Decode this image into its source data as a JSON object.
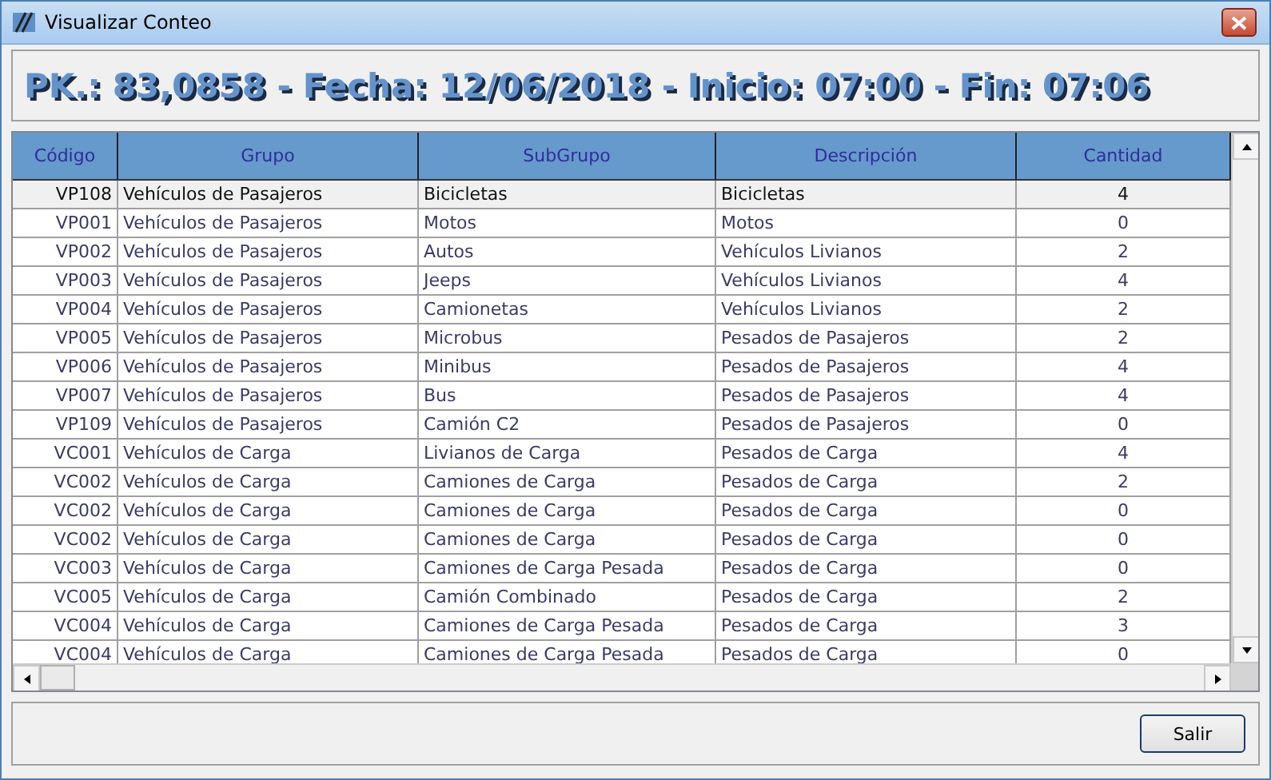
{
  "window": {
    "title": "Visualizar Conteo"
  },
  "header": {
    "text": "PK.: 83,0858 - Fecha: 12/06/2018 - Inicio: 07:00 - Fin: 07:06"
  },
  "table": {
    "columns": [
      "Código",
      "Grupo",
      "SubGrupo",
      "Descripción",
      "Cantidad"
    ],
    "rows": [
      {
        "cells": [
          "VP108",
          "Vehículos de Pasajeros",
          "Bicicletas",
          "Bicicletas",
          "4"
        ],
        "selected": true
      },
      {
        "cells": [
          "VP001",
          "Vehículos de Pasajeros",
          "Motos",
          "Motos",
          "0"
        ],
        "selected": false
      },
      {
        "cells": [
          "VP002",
          "Vehículos de Pasajeros",
          "Autos",
          "Vehículos Livianos",
          "2"
        ],
        "selected": false
      },
      {
        "cells": [
          "VP003",
          "Vehículos de Pasajeros",
          "Jeeps",
          "Vehículos Livianos",
          "4"
        ],
        "selected": false
      },
      {
        "cells": [
          "VP004",
          "Vehículos de Pasajeros",
          "Camionetas",
          "Vehículos Livianos",
          "2"
        ],
        "selected": false
      },
      {
        "cells": [
          "VP005",
          "Vehículos de Pasajeros",
          "Microbus",
          "Pesados de Pasajeros",
          "2"
        ],
        "selected": false
      },
      {
        "cells": [
          "VP006",
          "Vehículos de Pasajeros",
          "Minibus",
          "Pesados de Pasajeros",
          "4"
        ],
        "selected": false
      },
      {
        "cells": [
          "VP007",
          "Vehículos de Pasajeros",
          "Bus",
          "Pesados de Pasajeros",
          "4"
        ],
        "selected": false
      },
      {
        "cells": [
          "VP109",
          "Vehículos de Pasajeros",
          "Camión C2",
          "Pesados de Pasajeros",
          "0"
        ],
        "selected": false
      },
      {
        "cells": [
          "VC001",
          "Vehículos de Carga",
          "Livianos de Carga",
          "Pesados de Carga",
          "4"
        ],
        "selected": false
      },
      {
        "cells": [
          "VC002",
          "Vehículos de Carga",
          "Camiones de Carga",
          "Pesados de Carga",
          "2"
        ],
        "selected": false
      },
      {
        "cells": [
          "VC002",
          "Vehículos de Carga",
          "Camiones de Carga",
          "Pesados de Carga",
          "0"
        ],
        "selected": false
      },
      {
        "cells": [
          "VC002",
          "Vehículos de Carga",
          "Camiones de Carga",
          "Pesados de Carga",
          "0"
        ],
        "selected": false
      },
      {
        "cells": [
          "VC003",
          "Vehículos de Carga",
          "Camiones de Carga Pesada",
          "Pesados de Carga",
          "0"
        ],
        "selected": false
      },
      {
        "cells": [
          "VC005",
          "Vehículos de Carga",
          "Camión Combinado",
          "Pesados de Carga",
          "2"
        ],
        "selected": false
      },
      {
        "cells": [
          "VC004",
          "Vehículos de Carga",
          "Camiones de Carga Pesada",
          "Pesados de Carga",
          "3"
        ],
        "selected": false
      },
      {
        "cells": [
          "VC004",
          "Vehículos de Carga",
          "Camiones de Carga Pesada",
          "Pesados de Carga",
          "0"
        ],
        "selected": false
      }
    ]
  },
  "buttons": [
    "Salir"
  ]
}
